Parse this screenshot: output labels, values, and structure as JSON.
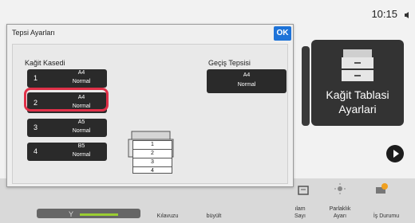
{
  "status": {
    "time": "10:15"
  },
  "dialog": {
    "title": "Tepsi Ayarları",
    "ok_label": "OK",
    "cassette_label": "Kağit Kasedi",
    "bypass_label": "Geçiş Tepsisi",
    "cassettes": [
      {
        "num": "1",
        "size": "A4",
        "type": "Normal"
      },
      {
        "num": "2",
        "size": "A4",
        "type": "Normal"
      },
      {
        "num": "3",
        "size": "A5",
        "type": "Normal"
      },
      {
        "num": "4",
        "size": "B5",
        "type": "Normal"
      }
    ],
    "bypass": {
      "size": "A4",
      "type": "Normal"
    },
    "tray_numbers": [
      "1",
      "2",
      "3",
      "4"
    ]
  },
  "tile": {
    "label_line1": "Kağit Tablasi",
    "label_line2": "Ayarlari"
  },
  "bottombar": {
    "y_label": "Y",
    "items": [
      {
        "line1": "Kılavuzu",
        "line2": ""
      },
      {
        "line1": "büyült",
        "line2": ""
      },
      {
        "line1": "ılam",
        "line2": "Sayı"
      },
      {
        "line1": "Parlaklık",
        "line2": "Ayarı"
      },
      {
        "line1": "İş Durumu",
        "line2": ""
      }
    ]
  },
  "colors": {
    "accent": "#1e73d8",
    "selection": "#e03048",
    "button": "#2a2a2a"
  }
}
